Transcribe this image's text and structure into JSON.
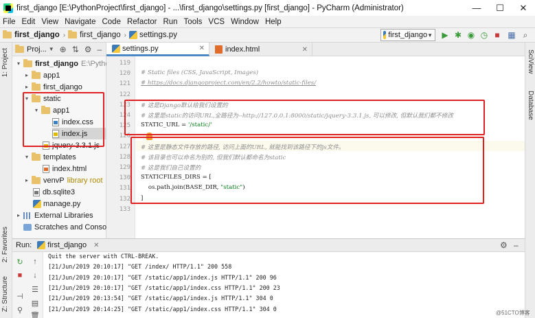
{
  "window": {
    "title": "first_django [E:\\PythonProject\\first_django] - ...\\first_django\\settings.py [first_django] - PyCharm (Administrator)",
    "controls": [
      "—",
      "☐",
      "✕"
    ]
  },
  "menu": [
    "File",
    "Edit",
    "View",
    "Navigate",
    "Code",
    "Refactor",
    "Run",
    "Tools",
    "VCS",
    "Window",
    "Help"
  ],
  "breadcrumb": [
    "first_django",
    "first_django",
    "settings.py"
  ],
  "run_config": "first_django",
  "left_tabs": [
    "1: Project",
    "2: Favorites",
    "Z: Structure"
  ],
  "right_tabs": [
    "SciView",
    "Database"
  ],
  "project_panel": {
    "header": "Proj...",
    "tree": [
      {
        "label": "first_django",
        "extra": "E:\\PythonPr",
        "icon": "folder-icon",
        "arrow": "▾"
      },
      {
        "label": "app1",
        "icon": "folder-icon",
        "arrow": "▸"
      },
      {
        "label": "first_django",
        "icon": "folder-icon",
        "arrow": "▸"
      },
      {
        "label": "static",
        "icon": "folder-icon",
        "arrow": "▾"
      },
      {
        "label": "app1",
        "icon": "folder-icon",
        "arrow": "▾"
      },
      {
        "label": "index.css",
        "icon": "css-file-icon"
      },
      {
        "label": "index.js",
        "icon": "js-file-icon"
      },
      {
        "label": "jquery-3.3.1.js",
        "icon": "js-file-icon"
      },
      {
        "label": "templates",
        "icon": "folder-icon",
        "arrow": "▾"
      },
      {
        "label": "index.html",
        "icon": "html-file-icon"
      },
      {
        "label": "venvP",
        "extra": "library root",
        "icon": "folder-icon",
        "arrow": "▸"
      },
      {
        "label": "db.sqlite3",
        "icon": "db-file-icon"
      },
      {
        "label": "manage.py",
        "icon": "python-file-icon"
      },
      {
        "label": "External Libraries",
        "icon": "library-icon",
        "arrow": "▸"
      },
      {
        "label": "Scratches and Consoles",
        "icon": "scratches-icon"
      }
    ]
  },
  "editor_tabs": [
    {
      "label": "settings.py",
      "active": true
    },
    {
      "label": "index.html",
      "active": false
    }
  ],
  "code_lines": [
    {
      "n": "119",
      "text": ""
    },
    {
      "n": "120",
      "text": "# Static files (CSS, JavaScript, Images)",
      "kind": "comment"
    },
    {
      "n": "121",
      "text": "# https://docs.djangoproject.com/en/2.2/howto/static-files/",
      "kind": "link"
    },
    {
      "n": "122",
      "text": ""
    },
    {
      "n": "123",
      "text": "# 这是Django默认给我们设置的",
      "kind": "comment"
    },
    {
      "n": "124",
      "text": "# 这里是static的访问URL,全路径为--http://127.0.0.1:8000/static/jquery-3.3.1.js, 可以修改, 但默认我们都不修改",
      "kind": "comment"
    },
    {
      "n": "125",
      "text": "STATIC_URL = '/static/'",
      "kind": "code"
    },
    {
      "n": "126",
      "text": ""
    },
    {
      "n": "127",
      "text": "# 这里是静态文件存放的路径, 访问上面的URL, 就能找到该路径下的js文件。",
      "kind": "comment"
    },
    {
      "n": "128",
      "text": "# 该目录也可以命名为别的, 但我们默认都命名为static",
      "kind": "comment"
    },
    {
      "n": "129",
      "text": "# 这是我们自己设置的",
      "kind": "comment"
    },
    {
      "n": "130",
      "text": "STATICFILES_DIRS = [",
      "kind": "code"
    },
    {
      "n": "131",
      "text": "    os.path.join(BASE_DIR, \"static\")",
      "kind": "code"
    },
    {
      "n": "132",
      "text": "]",
      "kind": "code"
    },
    {
      "n": "133",
      "text": ""
    }
  ],
  "run_panel": {
    "label": "Run:",
    "tab": "first_django",
    "lines": [
      "Quit the server with CTRL-BREAK.",
      "[21/Jun/2019 20:10:17] \"GET /index/ HTTP/1.1\" 200 558",
      "[21/Jun/2019 20:10:17] \"GET /static/app1/index.js HTTP/1.1\" 200 96",
      "[21/Jun/2019 20:10:17] \"GET /static/app1/index.css HTTP/1.1\" 200 23",
      "[21/Jun/2019 20:13:54] \"GET /static/app1/index.js HTTP/1.1\" 304 0",
      "[21/Jun/2019 20:14:25] \"GET /static/app1/index.css HTTP/1.1\" 304 0"
    ]
  },
  "watermark": "@51CTO博客",
  "colors": {
    "highlight_box": "#e02020",
    "active_tab": "#4a88c7",
    "string": "#067d17",
    "comment": "#8c8c8c"
  }
}
